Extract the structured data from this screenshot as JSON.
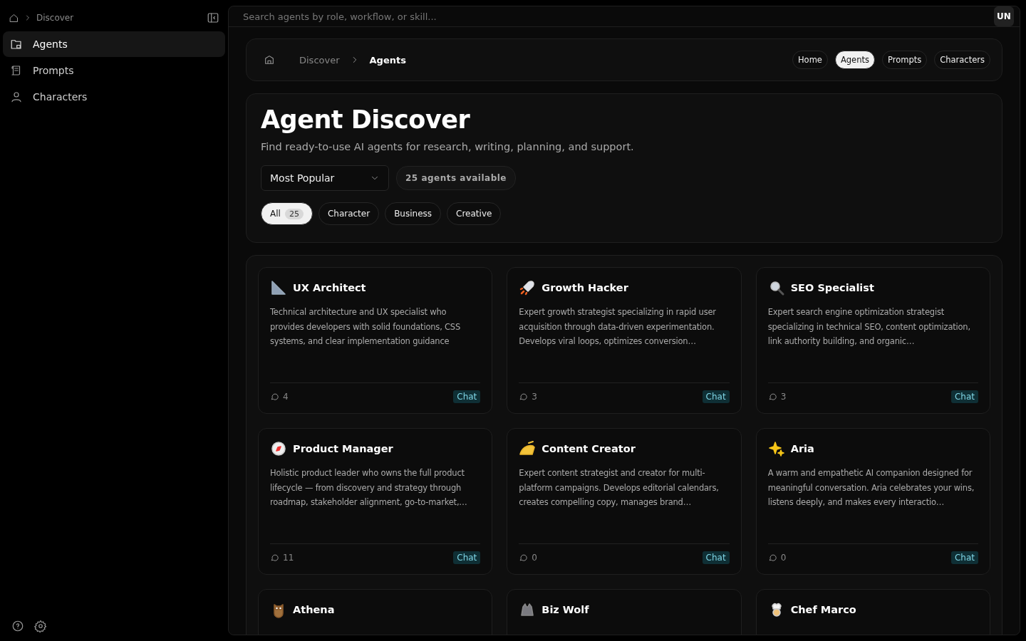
{
  "sidebar": {
    "breadcrumb": "Discover",
    "items": [
      {
        "label": "Agents",
        "selected": true
      },
      {
        "label": "Prompts",
        "selected": false
      },
      {
        "label": "Characters",
        "selected": false
      }
    ]
  },
  "search": {
    "placeholder": "Search agents by role, workflow, or skill..."
  },
  "avatar": "UN",
  "breadcrumb": {
    "parent": "Discover",
    "current": "Agents"
  },
  "nav_pills": [
    {
      "label": "Home",
      "selected": false
    },
    {
      "label": "Agents",
      "selected": true
    },
    {
      "label": "Prompts",
      "selected": false
    },
    {
      "label": "Characters",
      "selected": false
    }
  ],
  "hero": {
    "title": "Agent Discover",
    "subtitle": "Find ready-to-use AI agents for research, writing, planning, and support.",
    "sort": "Most Popular",
    "count_badge": "25 agents available"
  },
  "filters": [
    {
      "label": "All",
      "count": "25",
      "selected": true
    },
    {
      "label": "Character",
      "selected": false
    },
    {
      "label": "Business",
      "selected": false
    },
    {
      "label": "Creative",
      "selected": false
    }
  ],
  "agents": [
    {
      "name": "UX Architect",
      "description": "Technical architecture and UX specialist who provides developers with solid foundations, CSS systems, and clear implementation guidance",
      "chats": "4",
      "action": "Chat"
    },
    {
      "name": "Growth Hacker",
      "description": "Expert growth strategist specializing in rapid user acquisition through data-driven experimentation. Develops viral loops, optimizes conversion…",
      "chats": "3",
      "action": "Chat"
    },
    {
      "name": "SEO Specialist",
      "description": "Expert search engine optimization strategist specializing in technical SEO, content optimization, link authority building, and organic…",
      "chats": "3",
      "action": "Chat"
    },
    {
      "name": "Product Manager",
      "description": "Holistic product leader who owns the full product lifecycle — from discovery and strategy through roadmap, stakeholder alignment, go-to-market,…",
      "chats": "11",
      "action": "Chat"
    },
    {
      "name": "Content Creator",
      "description": "Expert content strategist and creator for multi-platform campaigns. Develops editorial calendars, creates compelling copy, manages brand…",
      "chats": "0",
      "action": "Chat"
    },
    {
      "name": "Aria",
      "description": "A warm and empathetic AI companion designed for meaningful conversation. Aria celebrates your wins, listens deeply, and makes every interactio…",
      "chats": "0",
      "action": "Chat"
    },
    {
      "name": "Athena"
    },
    {
      "name": "Biz Wolf"
    },
    {
      "name": "Chef Marco"
    }
  ]
}
